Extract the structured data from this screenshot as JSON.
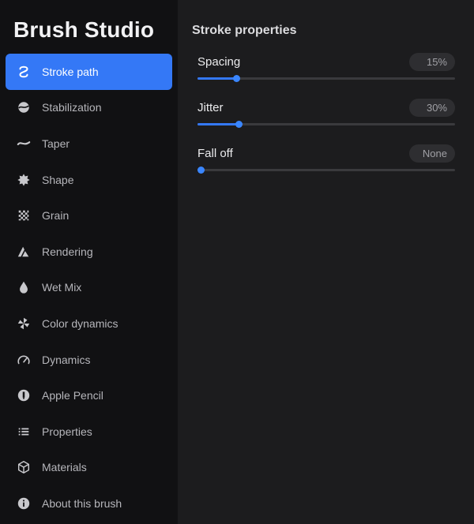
{
  "sidebar": {
    "title": "Brush Studio",
    "items": [
      {
        "label": "Stroke path",
        "icon": "stroke-path-icon",
        "active": true
      },
      {
        "label": "Stabilization",
        "icon": "stabilization-icon"
      },
      {
        "label": "Taper",
        "icon": "taper-icon"
      },
      {
        "label": "Shape",
        "icon": "shape-icon"
      },
      {
        "label": "Grain",
        "icon": "grain-icon"
      },
      {
        "label": "Rendering",
        "icon": "rendering-icon"
      },
      {
        "label": "Wet Mix",
        "icon": "droplet-icon"
      },
      {
        "label": "Color dynamics",
        "icon": "pinwheel-icon"
      },
      {
        "label": "Dynamics",
        "icon": "gauge-icon"
      },
      {
        "label": "Apple Pencil",
        "icon": "pencil-icon"
      },
      {
        "label": "Properties",
        "icon": "list-icon"
      },
      {
        "label": "Materials",
        "icon": "cube-icon"
      },
      {
        "label": "About this brush",
        "icon": "info-icon"
      }
    ]
  },
  "main": {
    "section_title": "Stroke properties",
    "properties": [
      {
        "name": "Spacing",
        "value": "15%",
        "level": 0.15
      },
      {
        "name": "Jitter",
        "value": "30%",
        "level": 0.16
      },
      {
        "name": "Fall off",
        "value": "None",
        "level": 0.0
      }
    ]
  },
  "colors": {
    "accent": "#3478f6",
    "sidebar_bg": "#111113",
    "panel_bg": "#1c1c1e"
  }
}
